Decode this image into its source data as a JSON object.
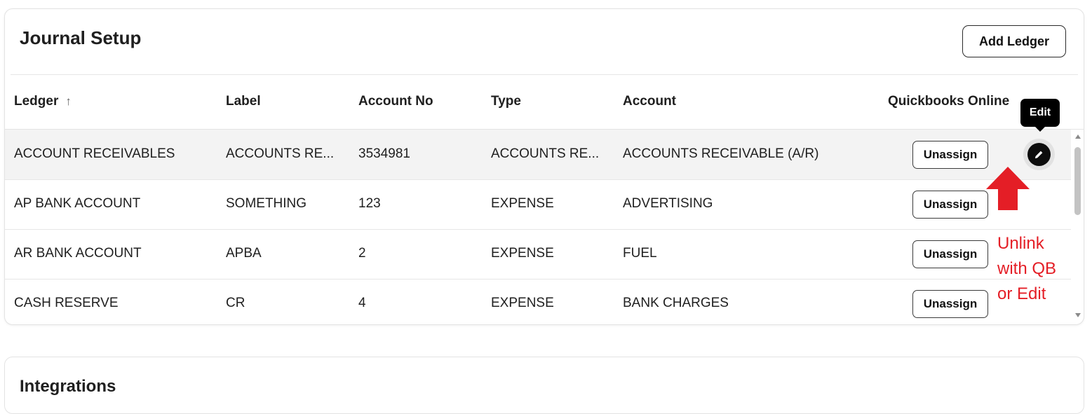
{
  "journal": {
    "title": "Journal Setup",
    "add_button_label": "Add Ledger",
    "columns": {
      "ledger": "Ledger",
      "label": "Label",
      "account_no": "Account No",
      "type": "Type",
      "account": "Account",
      "qbo": "Quickbooks Online"
    },
    "sort_icon": "arrow-up-icon",
    "rows": [
      {
        "ledger": "ACCOUNT RECEIVABLES",
        "label": "ACCOUNTS RE...",
        "account_no": "3534981",
        "type": "ACCOUNTS RE...",
        "account": "ACCOUNTS RECEIVABLE (A/R)",
        "action": "Unassign"
      },
      {
        "ledger": "AP BANK ACCOUNT",
        "label": "SOMETHING",
        "account_no": "123",
        "type": "EXPENSE",
        "account": "ADVERTISING",
        "action": "Unassign"
      },
      {
        "ledger": "AR BANK ACCOUNT",
        "label": "APBA",
        "account_no": "2",
        "type": "EXPENSE",
        "account": "FUEL",
        "action": "Unassign"
      },
      {
        "ledger": "CASH RESERVE",
        "label": "CR",
        "account_no": "4",
        "type": "EXPENSE",
        "account": "BANK CHARGES",
        "action": "Unassign"
      }
    ],
    "edit_tooltip": "Edit",
    "edit_icon": "pencil-icon"
  },
  "annotation": {
    "lines": [
      "Unlink",
      "with QB",
      "or Edit"
    ],
    "color": "#e41e26"
  },
  "integrations": {
    "title": "Integrations"
  }
}
